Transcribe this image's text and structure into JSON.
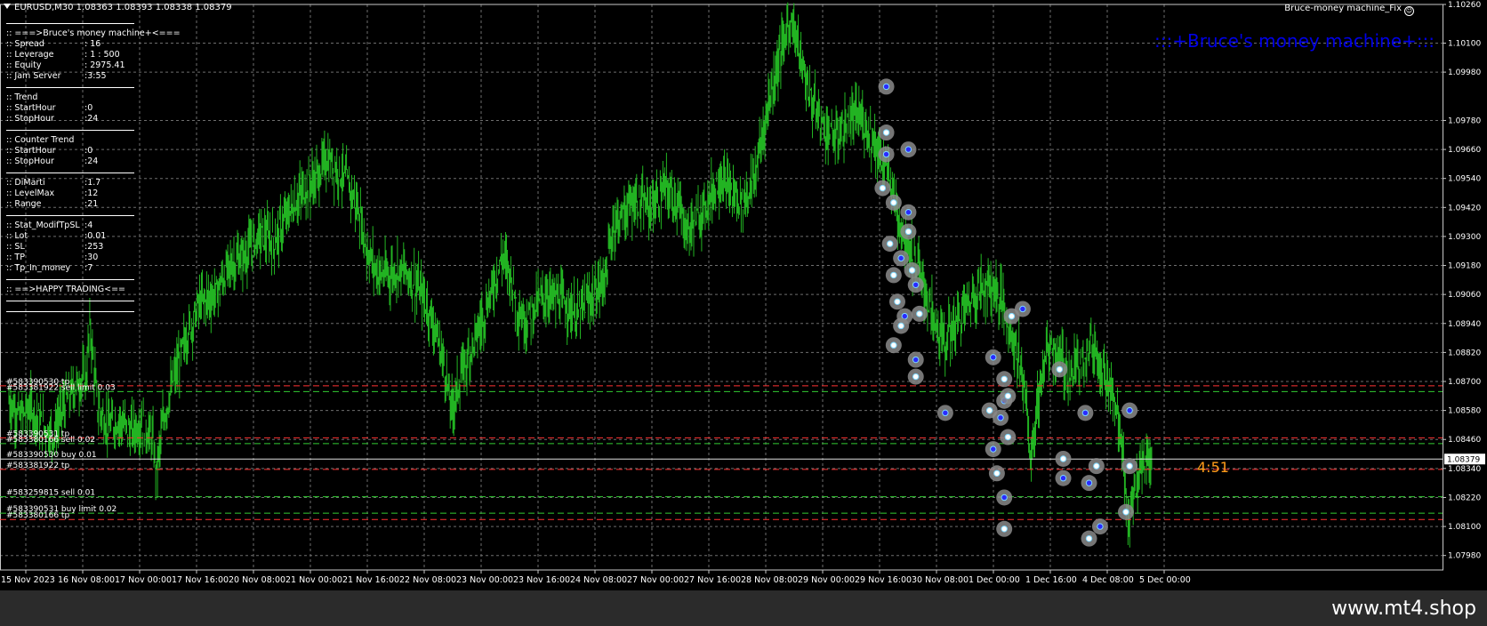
{
  "header": {
    "symbol_line": "EURUSD,M30  1.08363 1.08393 1.08338 1.08379"
  },
  "ea_label": "Bruce-money machine_Fix",
  "ea_icon": "smiley-icon",
  "brand_title": ":::+Bruce's money machine+:::",
  "countdown": "4:51",
  "panel": [
    {
      "type": "sep"
    },
    {
      "type": "row",
      "k": ":: ===>Bruce's money machine+<===",
      "v": ""
    },
    {
      "type": "row",
      "k": ":: Spread",
      "v": ": 16"
    },
    {
      "type": "row",
      "k": ":: Leverage",
      "v": ": 1 : 500"
    },
    {
      "type": "row",
      "k": ":: Equity",
      "v": ": 2975.41"
    },
    {
      "type": "row",
      "k": ":: Jam Server",
      "v": ":3:55"
    },
    {
      "type": "sep"
    },
    {
      "type": "row",
      "k": ":: Trend",
      "v": ""
    },
    {
      "type": "row",
      "k": ":: StartHour",
      "v": ":0"
    },
    {
      "type": "row",
      "k": ":: StopHour",
      "v": ":24"
    },
    {
      "type": "sep"
    },
    {
      "type": "row",
      "k": ":: Counter Trend",
      "v": ""
    },
    {
      "type": "row",
      "k": ":: StartHour",
      "v": ":0"
    },
    {
      "type": "row",
      "k": ":: StopHour",
      "v": ":24"
    },
    {
      "type": "sep"
    },
    {
      "type": "row",
      "k": ":: DiMarti",
      "v": ":1.7"
    },
    {
      "type": "row",
      "k": ":: LevelMax",
      "v": ":12"
    },
    {
      "type": "row",
      "k": ":: Range",
      "v": ":21"
    },
    {
      "type": "sep"
    },
    {
      "type": "row",
      "k": ":: Stat_ModifTpSL",
      "v": ":4"
    },
    {
      "type": "row",
      "k": ":: Lot",
      "v": ":0.01"
    },
    {
      "type": "row",
      "k": ":: SL",
      "v": ":253"
    },
    {
      "type": "row",
      "k": ":: TP",
      "v": ":30"
    },
    {
      "type": "row",
      "k": ":: Tp_In_money",
      "v": ":7"
    },
    {
      "type": "sep"
    },
    {
      "type": "row",
      "k": ":: ==>HAPPY TRADING<==",
      "v": ""
    },
    {
      "type": "sep"
    },
    {
      "type": "sep"
    }
  ],
  "footer_text": "www.mt4.shop",
  "colors": {
    "background": "#000000",
    "grid": "#6e6e6e",
    "candles": "#22b322",
    "tp_line": "#ff3333",
    "order_line": "#33cc33",
    "brand": "#0000e6",
    "countdown": "#ff9d1a",
    "marker_ring": "#8a8a8a",
    "marker_buy": "#2a2aff",
    "marker_sell": "#ffffff"
  },
  "chart_data": {
    "type": "candlestick",
    "symbol": "EURUSD",
    "timeframe": "M30",
    "ylim": [
      1.0792,
      1.1026
    ],
    "y_ticks": [
      "1.10260",
      "1.10100",
      "1.09980",
      "1.09780",
      "1.09660",
      "1.09540",
      "1.09420",
      "1.09300",
      "1.09180",
      "1.09060",
      "1.08940",
      "1.08820",
      "1.08700",
      "1.08580",
      "1.08460",
      "1.08340",
      "1.08220",
      "1.08100",
      "1.07980"
    ],
    "x_ticks": [
      "15 Nov 2023",
      "16 Nov 08:00",
      "17 Nov 00:00",
      "17 Nov 16:00",
      "20 Nov 08:00",
      "21 Nov 00:00",
      "21 Nov 16:00",
      "22 Nov 08:00",
      "23 Nov 00:00",
      "23 Nov 16:00",
      "24 Nov 08:00",
      "27 Nov 00:00",
      "27 Nov 16:00",
      "28 Nov 08:00",
      "29 Nov 00:00",
      "29 Nov 16:00",
      "30 Nov 08:00",
      "1 Dec 00:00",
      "1 Dec 16:00",
      "4 Dec 08:00",
      "5 Dec 00:00"
    ],
    "current_price": "1.08379",
    "price_path": [
      [
        0,
        1.0862
      ],
      [
        3,
        1.0855
      ],
      [
        6,
        1.0859
      ],
      [
        9,
        1.0852
      ],
      [
        12,
        1.0848
      ],
      [
        15,
        1.086
      ],
      [
        18,
        1.0868
      ],
      [
        21,
        1.0872
      ],
      [
        22,
        1.0894
      ],
      [
        24,
        1.086
      ],
      [
        27,
        1.0851
      ],
      [
        30,
        1.0854
      ],
      [
        33,
        1.0849
      ],
      [
        36,
        1.0853
      ],
      [
        39,
        1.0846
      ],
      [
        40,
        1.0832
      ],
      [
        42,
        1.0855
      ],
      [
        45,
        1.0872
      ],
      [
        48,
        1.0888
      ],
      [
        52,
        1.0903
      ],
      [
        56,
        1.0906
      ],
      [
        60,
        1.0918
      ],
      [
        64,
        1.0922
      ],
      [
        68,
        1.0931
      ],
      [
        72,
        1.0928
      ],
      [
        76,
        1.094
      ],
      [
        80,
        1.0949
      ],
      [
        84,
        1.0955
      ],
      [
        86,
        1.0962
      ],
      [
        89,
        1.0958
      ],
      [
        92,
        1.0952
      ],
      [
        95,
        1.094
      ],
      [
        97,
        1.0925
      ],
      [
        100,
        1.0915
      ],
      [
        103,
        1.0914
      ],
      [
        106,
        1.0917
      ],
      [
        109,
        1.0913
      ],
      [
        112,
        1.0906
      ],
      [
        115,
        1.0895
      ],
      [
        118,
        1.0878
      ],
      [
        120,
        1.0858
      ],
      [
        123,
        1.0874
      ],
      [
        126,
        1.0886
      ],
      [
        129,
        1.0898
      ],
      [
        132,
        1.0913
      ],
      [
        134,
        1.0922
      ],
      [
        136,
        1.0915
      ],
      [
        138,
        1.09
      ],
      [
        140,
        1.0895
      ],
      [
        143,
        1.0902
      ],
      [
        146,
        1.0906
      ],
      [
        149,
        1.0904
      ],
      [
        152,
        1.0901
      ],
      [
        154,
        1.0897
      ],
      [
        157,
        1.0903
      ],
      [
        160,
        1.0908
      ],
      [
        162,
        1.0915
      ],
      [
        164,
        1.0935
      ],
      [
        167,
        1.094
      ],
      [
        170,
        1.0945
      ],
      [
        173,
        1.0942
      ],
      [
        176,
        1.0944
      ],
      [
        178,
        1.095
      ],
      [
        181,
        1.0945
      ],
      [
        184,
        1.0932
      ],
      [
        187,
        1.0938
      ],
      [
        190,
        1.0946
      ],
      [
        193,
        1.0954
      ],
      [
        196,
        1.0948
      ],
      [
        199,
        1.0944
      ],
      [
        202,
        1.0953
      ],
      [
        204,
        1.0968
      ],
      [
        206,
        1.0985
      ],
      [
        208,
        1.0998
      ],
      [
        210,
        1.101
      ],
      [
        212,
        1.102
      ],
      [
        214,
        1.101
      ],
      [
        216,
        1.0995
      ],
      [
        218,
        1.0985
      ],
      [
        221,
        1.0976
      ],
      [
        224,
        1.097
      ],
      [
        227,
        1.0975
      ],
      [
        230,
        1.098
      ],
      [
        233,
        1.0975
      ],
      [
        235,
        1.0968
      ],
      [
        237,
        1.096
      ],
      [
        239,
        1.0955
      ],
      [
        241,
        1.094
      ],
      [
        243,
        1.093
      ],
      [
        245,
        1.0922
      ],
      [
        247,
        1.0915
      ],
      [
        249,
        1.0905
      ],
      [
        251,
        1.0895
      ],
      [
        254,
        1.0886
      ],
      [
        257,
        1.0895
      ],
      [
        260,
        1.0902
      ],
      [
        263,
        1.0908
      ],
      [
        266,
        1.091
      ],
      [
        269,
        1.0905
      ],
      [
        272,
        1.089
      ],
      [
        274,
        1.088
      ],
      [
        276,
        1.0865
      ],
      [
        277,
        1.0835
      ],
      [
        278,
        1.0848
      ],
      [
        280,
        1.087
      ],
      [
        282,
        1.0885
      ],
      [
        285,
        1.088
      ],
      [
        288,
        1.0872
      ],
      [
        291,
        1.088
      ],
      [
        294,
        1.0885
      ],
      [
        297,
        1.0875
      ],
      [
        300,
        1.086
      ],
      [
        302,
        1.0845
      ],
      [
        303,
        1.082
      ],
      [
        304,
        1.0812
      ],
      [
        306,
        1.0828
      ],
      [
        308,
        1.0835
      ],
      [
        310,
        1.0838
      ]
    ],
    "x_max": 310,
    "lines": [
      {
        "label": "#583390530 tp",
        "price": 1.08682,
        "color": "red",
        "style": "dashed"
      },
      {
        "label": "#583381922 sell limit 0.03",
        "price": 1.08658,
        "color": "green",
        "style": "dashed"
      },
      {
        "label": "#583390531 tp",
        "price": 1.08467,
        "color": "red",
        "style": "dashed"
      },
      {
        "label": "#583380166 sell 0.02",
        "price": 1.08443,
        "color": "green",
        "style": "dashed"
      },
      {
        "label": "#583390530 buy 0.01",
        "price": 1.08379,
        "color": "white",
        "style": "solid"
      },
      {
        "label": "#583381922 tp",
        "price": 1.08336,
        "color": "red",
        "style": "dashed"
      },
      {
        "label": "#583259815 sell 0.01",
        "price": 1.08223,
        "color": "green",
        "style": "dashed"
      },
      {
        "label": "#583390531 buy limit 0.02",
        "price": 1.08155,
        "color": "green",
        "style": "dashed"
      },
      {
        "label": "#583380166 tp",
        "price": 1.08129,
        "color": "red",
        "style": "dashed"
      }
    ],
    "markers": [
      [
        238,
        1.0992,
        "b"
      ],
      [
        238,
        1.0973,
        "s"
      ],
      [
        238,
        1.0964,
        "b"
      ],
      [
        244,
        1.0966,
        "b"
      ],
      [
        237,
        1.095,
        "s"
      ],
      [
        240,
        1.0944,
        "s"
      ],
      [
        244,
        1.094,
        "b"
      ],
      [
        244,
        1.0932,
        "s"
      ],
      [
        239,
        1.0927,
        "s"
      ],
      [
        240,
        1.0914,
        "s"
      ],
      [
        242,
        1.0921,
        "b"
      ],
      [
        245,
        1.0916,
        "s"
      ],
      [
        246,
        1.091,
        "b"
      ],
      [
        241,
        1.0903,
        "s"
      ],
      [
        243,
        1.0897,
        "b"
      ],
      [
        247,
        1.0898,
        "s"
      ],
      [
        242,
        1.0893,
        "s"
      ],
      [
        240,
        1.0885,
        "s"
      ],
      [
        246,
        1.0879,
        "b"
      ],
      [
        246,
        1.0872,
        "s"
      ],
      [
        254,
        1.0857,
        "b"
      ],
      [
        272,
        1.0897,
        "s"
      ],
      [
        267,
        1.088,
        "b"
      ],
      [
        270,
        1.0871,
        "s"
      ],
      [
        270,
        1.0862,
        "b"
      ],
      [
        271,
        1.0864,
        "s"
      ],
      [
        269,
        1.0855,
        "b"
      ],
      [
        271,
        1.0847,
        "s"
      ],
      [
        266,
        1.0858,
        "s"
      ],
      [
        267,
        1.0842,
        "b"
      ],
      [
        268,
        1.0832,
        "s"
      ],
      [
        270,
        1.0822,
        "b"
      ],
      [
        270,
        1.0809,
        "s"
      ],
      [
        285,
        1.0875,
        "s"
      ],
      [
        292,
        1.0857,
        "b"
      ],
      [
        286,
        1.0838,
        "s"
      ],
      [
        286,
        1.083,
        "b"
      ],
      [
        295,
        1.0835,
        "s"
      ],
      [
        293,
        1.0828,
        "b"
      ],
      [
        296,
        1.081,
        "b"
      ],
      [
        293,
        1.0805,
        "s"
      ],
      [
        303,
        1.0816,
        "s"
      ],
      [
        304,
        1.0858,
        "b"
      ],
      [
        304,
        1.0835,
        "s"
      ],
      [
        275,
        1.09,
        "b"
      ]
    ]
  }
}
